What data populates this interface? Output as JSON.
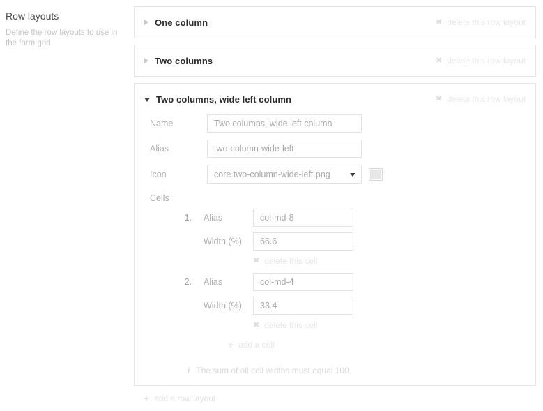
{
  "sidebar": {
    "title": "Row layouts",
    "description": "Define the row layouts to use in the form grid"
  },
  "panels": [
    {
      "title": "One column",
      "expanded": false,
      "caret_icon": "caret-right-icon",
      "delete_label": "delete this row layout",
      "delete_icon": "close-x-icon"
    },
    {
      "title": "Two columns",
      "expanded": false,
      "caret_icon": "caret-right-icon",
      "delete_label": "delete this row layout",
      "delete_icon": "close-x-icon"
    },
    {
      "title": "Two columns, wide left column",
      "expanded": true,
      "caret_icon": "caret-down-icon",
      "delete_label": "delete this row layout",
      "delete_icon": "close-x-icon"
    }
  ],
  "form": {
    "name_label": "Name",
    "name_value": "Two columns, wide left column",
    "alias_label": "Alias",
    "alias_value": "two-column-wide-left",
    "icon_label": "Icon",
    "icon_value": "core.two-column-wide-left.png",
    "icon_preview_name": "two-column-wide-left-preview-icon",
    "cells_label": "Cells",
    "cells": [
      {
        "index": "1.",
        "alias_label": "Alias",
        "alias_value": "col-md-8",
        "width_label": "Width (%)",
        "width_value": "66.6",
        "delete_label": "delete this cell",
        "delete_icon": "close-x-icon"
      },
      {
        "index": "2.",
        "alias_label": "Alias",
        "alias_value": "col-md-4",
        "width_label": "Width (%)",
        "width_value": "33.4",
        "delete_label": "delete this cell",
        "delete_icon": "close-x-icon"
      }
    ],
    "add_cell_label": "add a cell",
    "add_cell_icon": "plus-icon",
    "hint_text": "The sum of all cell widths must equal 100.",
    "hint_icon": "info-icon"
  },
  "footer": {
    "add_row_layout_label": "add a row layout",
    "add_row_layout_icon": "plus-icon"
  },
  "glyphs": {
    "x": "✖",
    "plus": "+",
    "info": "i"
  }
}
